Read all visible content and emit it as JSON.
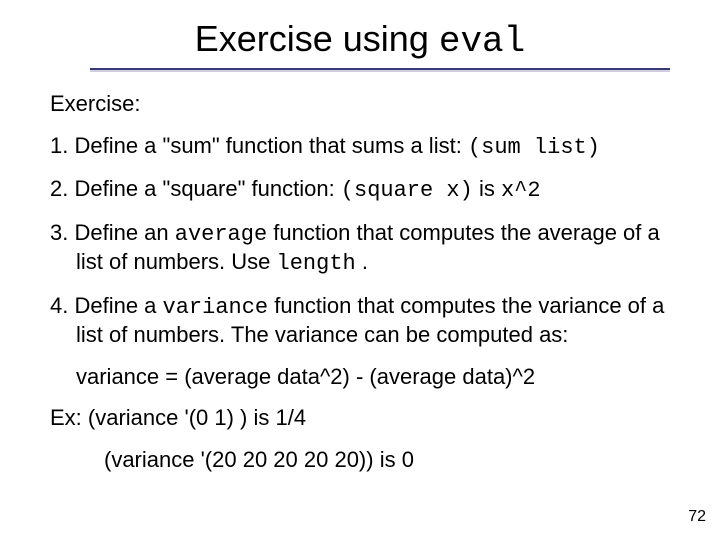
{
  "title": {
    "pre": "Exercise using ",
    "code": "eval"
  },
  "body": {
    "exercise_label": "Exercise:",
    "item1": {
      "pre": "1. Define a \"sum\" function that sums a list: ",
      "code": "(sum list)"
    },
    "item2": {
      "pre": "2. Define a \"square\" function: ",
      "code1": "(square x)",
      "mid": " is ",
      "code2": "x^2"
    },
    "item3": {
      "pre": "3. Define an ",
      "code1": "average",
      "post": " function that computes the average of a list of numbers.  Use ",
      "code2": "length",
      "tail": " ."
    },
    "item4": {
      "pre": "4. Define a ",
      "code1": "variance",
      "post": " function that computes the variance of a list of numbers.  The variance can be computed as:"
    },
    "formula": "variance = (average data^2) - (average data)^2",
    "ex1": "Ex: (variance '(0 1) ) is 1/4",
    "ex2": "(variance '(20 20 20 20 20)) is 0"
  },
  "page_number": "72"
}
